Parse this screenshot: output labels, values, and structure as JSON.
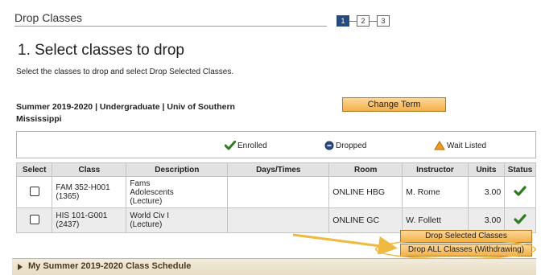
{
  "header": {
    "title": "Drop Classes",
    "steps": [
      "1",
      "2",
      "3"
    ]
  },
  "heading": "1.  Select classes to drop",
  "instructions": "Select the classes to drop and select Drop Selected Classes.",
  "term": {
    "text": "Summer 2019-2020 | Undergraduate | Univ of Southern Mississippi",
    "change_term_label": "Change Term"
  },
  "legend": {
    "enrolled": "Enrolled",
    "dropped": "Dropped",
    "wait_listed": "Wait Listed"
  },
  "table": {
    "headers": [
      "Select",
      "Class",
      "Description",
      "Days/Times",
      "Room",
      "Instructor",
      "Units",
      "Status"
    ],
    "rows": [
      {
        "class_code": "FAM 352-H001",
        "class_number": "(1365)",
        "desc_lines": [
          "Fams",
          "Adolescents",
          "(Lecture)"
        ],
        "days_times": "",
        "room": "ONLINE HBG",
        "instructor": "M. Rome",
        "units": "3.00",
        "status": "Enrolled"
      },
      {
        "class_code": "HIS 101-G001",
        "class_number": "(2437)",
        "desc_lines": [
          "World Civ I",
          "(Lecture)"
        ],
        "days_times": "",
        "room": "ONLINE GC",
        "instructor": "W. Follett",
        "units": "3.00",
        "status": "Enrolled"
      }
    ]
  },
  "actions": {
    "drop_selected": "Drop Selected Classes",
    "drop_all": "Drop ALL Classes (Withdrawing)"
  },
  "schedule": {
    "label": "My Summer 2019-2020 Class Schedule"
  },
  "colors": {
    "accent_orange": "#f4b048",
    "link_blue": "#2a4e8a",
    "check_green": "#2f7d20",
    "highlight_yellow": "#f0b942"
  }
}
